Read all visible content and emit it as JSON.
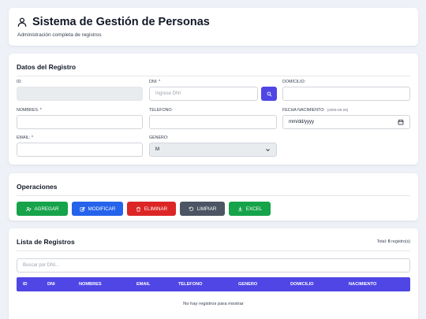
{
  "header": {
    "title": "Sistema de Gestión de Personas",
    "subtitle": "Administración completa de registros"
  },
  "form": {
    "title": "Datos del Registro",
    "fields": {
      "id": {
        "label": "ID:",
        "value": ""
      },
      "dni": {
        "label": "DNI: *",
        "placeholder": "Ingrese DNI"
      },
      "domicilio": {
        "label": "DOMICILIO:",
        "value": ""
      },
      "nombres": {
        "label": "NOMBRES: *",
        "value": ""
      },
      "telefono": {
        "label": "TELEFONO:",
        "value": ""
      },
      "fecha": {
        "label": "FECHA NACIMIENTO:",
        "hint": "(2005-05-25)",
        "value": "mm/dd/yyyy"
      },
      "email": {
        "label": "EMAIL: *",
        "value": ""
      },
      "genero": {
        "label": "GENERO:",
        "selected": "M"
      }
    }
  },
  "operations": {
    "title": "Operaciones",
    "buttons": [
      {
        "label": "AGREGAR",
        "color": "#16a34a",
        "icon": "add-user-icon"
      },
      {
        "label": "MODIFICAR",
        "color": "#2563eb",
        "icon": "edit-icon"
      },
      {
        "label": "ELIMINAR",
        "color": "#dc2626",
        "icon": "trash-icon"
      },
      {
        "label": "LIMPIAR",
        "color": "#4b5563",
        "icon": "undo-icon"
      },
      {
        "label": "EXCEL",
        "color": "#16a34a",
        "icon": "download-icon"
      }
    ]
  },
  "list": {
    "title": "Lista de Registros",
    "total_prefix": "Total: ",
    "total_count": "0",
    "total_suffix": " registro(s)",
    "search_placeholder": "Buscar por DNI...",
    "columns": [
      "ID",
      "DNI",
      "NOMBRES",
      "EMAIL",
      "TELEFONO",
      "GENERO",
      "DOMICILIO",
      "NACIMIENTO"
    ],
    "empty_message": "No hay registros para mostrar"
  },
  "colors": {
    "primary": "#4f46e5",
    "background": "#eef1f7"
  }
}
